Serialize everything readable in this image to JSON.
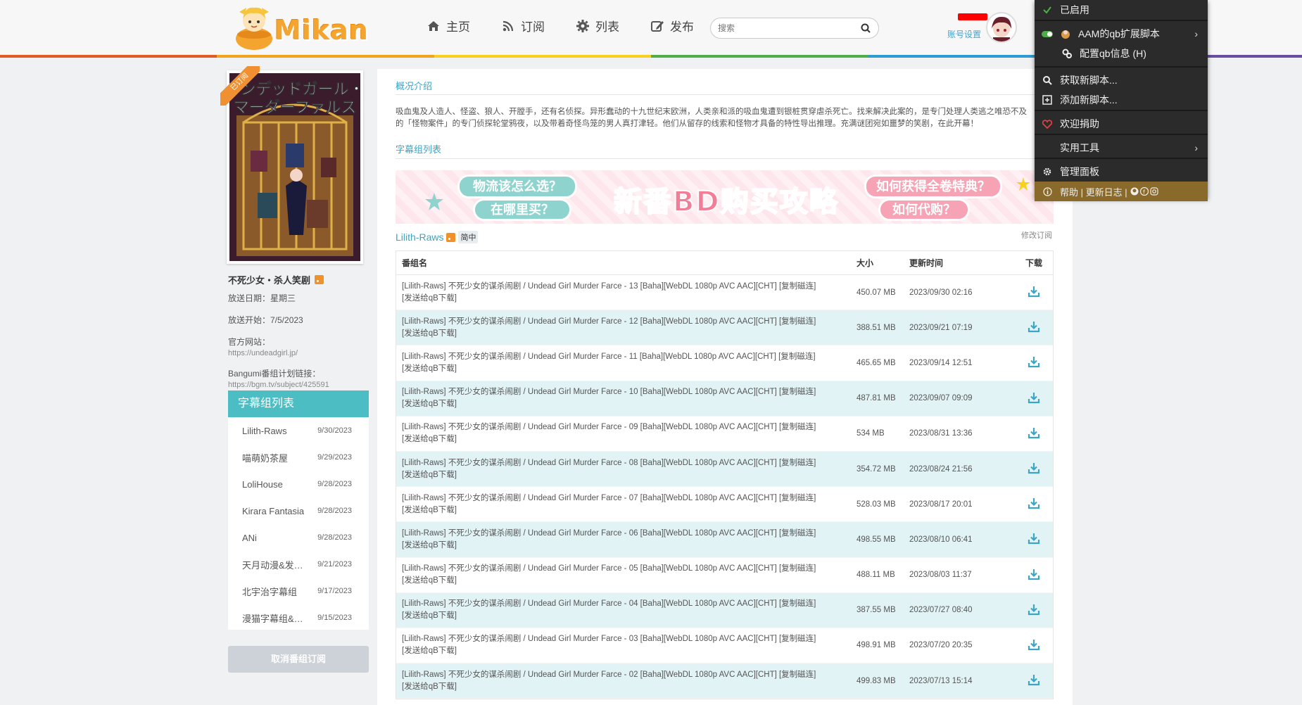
{
  "header": {
    "logo_text": "Mikan",
    "nav": [
      {
        "label": "主页",
        "icon": "home-icon"
      },
      {
        "label": "订阅",
        "icon": "rss-icon"
      },
      {
        "label": "列表",
        "icon": "gear-list-icon"
      },
      {
        "label": "发布",
        "icon": "edit-icon"
      }
    ],
    "search_placeholder": "搜索",
    "account_label": "账号设置"
  },
  "rainbow_colors": [
    "#e35a26",
    "#f2a31c",
    "#f7d11e",
    "#4fae4a",
    "#2d9bd6",
    "#6a4ea5"
  ],
  "sidebar": {
    "badge": "已订阅",
    "title": "不死少女・杀人笑剧",
    "air_day": "放送日期：星期三",
    "air_start": "放送开始：7/5/2023",
    "official_label": "官方网站：",
    "official_url": "https://undeadgirl.jp/",
    "bangumi_label": "Bangumi番组计划链接：",
    "bangumi_url": "https://bgm.tv/subject/425591",
    "fansub_title": "字幕组列表",
    "fansubs": [
      {
        "name": "Lilith-Raws",
        "date": "9/30/2023"
      },
      {
        "name": "喵萌奶茶屋",
        "date": "9/29/2023"
      },
      {
        "name": "LoliHouse",
        "date": "9/28/2023"
      },
      {
        "name": "Kirara Fantasia",
        "date": "9/28/2023"
      },
      {
        "name": "ANi",
        "date": "9/28/2023"
      },
      {
        "name": "天月动漫&发…",
        "date": "9/21/2023"
      },
      {
        "name": "北宇治字幕组",
        "date": "9/17/2023"
      },
      {
        "name": "漫猫字幕组&…",
        "date": "9/15/2023"
      }
    ],
    "unsubscribe": "取消番组订阅"
  },
  "main": {
    "overview_label": "概况介绍",
    "desc_line1": "吸血鬼及人造人、怪盗、狼人、开膛手，还有名侦探。异形蠢动的十九世纪末欧洲，人类亲和派的吸血鬼遭到银桩贯穿虐杀死亡。找来解决此案的，是专门处理人类逃之唯恐不及",
    "desc_line2": "的「怪物案件」的专门侦探轮堂鸦夜，以及带着奇怪鸟笼的男人真打津轻。他们从留存的线索和怪物才具备的特性导出推理。充满谜团宛如噩梦的笑剧，在此开幕！",
    "fansub_label": "字幕组列表",
    "banner": {
      "pill1": "物流该怎么选？",
      "pill2": "在哪里买？",
      "main_a": "新番",
      "main_b": "BD",
      "main_c": "购买攻略",
      "pill3": "如何获得全卷特典？",
      "pill4": "如何代购？"
    },
    "group_name": "Lilith-Raws",
    "lang_tag": "简中",
    "edit_sub": "修改订阅",
    "table": {
      "headers": {
        "name": "番组名",
        "size": "大小",
        "time": "更新时间",
        "download": "下载"
      },
      "rows": [
        {
          "name": "[Lilith-Raws] 不死少女的谋杀闹剧 / Undead Girl Murder Farce - 13 [Baha][WebDL 1080p AVC AAC][CHT] [复制磁连]",
          "push": "[发送给qB下载]",
          "size": "450.07 MB",
          "time": "2023/09/30 02:16"
        },
        {
          "name": "[Lilith-Raws] 不死少女的谋杀闹剧 / Undead Girl Murder Farce - 12 [Baha][WebDL 1080p AVC AAC][CHT] [复制磁连]",
          "push": "[发送给qB下载]",
          "size": "388.51 MB",
          "time": "2023/09/21 07:19"
        },
        {
          "name": "[Lilith-Raws] 不死少女的谋杀闹剧 / Undead Girl Murder Farce - 11 [Baha][WebDL 1080p AVC AAC][CHT] [复制磁连]",
          "push": "[发送给qB下载]",
          "size": "465.65 MB",
          "time": "2023/09/14 12:51"
        },
        {
          "name": "[Lilith-Raws] 不死少女的谋杀闹剧 / Undead Girl Murder Farce - 10 [Baha][WebDL 1080p AVC AAC][CHT] [复制磁连]",
          "push": "[发送给qB下载]",
          "size": "487.81 MB",
          "time": "2023/09/07 09:09"
        },
        {
          "name": "[Lilith-Raws] 不死少女的谋杀闹剧 / Undead Girl Murder Farce - 09 [Baha][WebDL 1080p AVC AAC][CHT] [复制磁连]",
          "push": "[发送给qB下载]",
          "size": "534 MB",
          "time": "2023/08/31 13:36"
        },
        {
          "name": "[Lilith-Raws] 不死少女的谋杀闹剧 / Undead Girl Murder Farce - 08 [Baha][WebDL 1080p AVC AAC][CHT] [复制磁连]",
          "push": "[发送给qB下载]",
          "size": "354.72 MB",
          "time": "2023/08/24 21:56"
        },
        {
          "name": "[Lilith-Raws] 不死少女的谋杀闹剧 / Undead Girl Murder Farce - 07 [Baha][WebDL 1080p AVC AAC][CHT] [复制磁连]",
          "push": "[发送给qB下载]",
          "size": "528.03 MB",
          "time": "2023/08/17 20:01"
        },
        {
          "name": "[Lilith-Raws] 不死少女的谋杀闹剧 / Undead Girl Murder Farce - 06 [Baha][WebDL 1080p AVC AAC][CHT] [复制磁连]",
          "push": "[发送给qB下载]",
          "size": "498.55 MB",
          "time": "2023/08/10 06:41"
        },
        {
          "name": "[Lilith-Raws] 不死少女的谋杀闹剧 / Undead Girl Murder Farce - 05 [Baha][WebDL 1080p AVC AAC][CHT] [复制磁连]",
          "push": "[发送给qB下载]",
          "size": "488.11 MB",
          "time": "2023/08/03 11:37"
        },
        {
          "name": "[Lilith-Raws] 不死少女的谋杀闹剧 / Undead Girl Murder Farce - 04 [Baha][WebDL 1080p AVC AAC][CHT] [复制磁连]",
          "push": "[发送给qB下载]",
          "size": "387.55 MB",
          "time": "2023/07/27 08:40"
        },
        {
          "name": "[Lilith-Raws] 不死少女的谋杀闹剧 / Undead Girl Murder Farce - 03 [Baha][WebDL 1080p AVC AAC][CHT] [复制磁连]",
          "push": "[发送给qB下载]",
          "size": "498.91 MB",
          "time": "2023/07/20 20:35"
        },
        {
          "name": "[Lilith-Raws] 不死少女的谋杀闹剧 / Undead Girl Murder Farce - 02 [Baha][WebDL 1080p AVC AAC][CHT] [复制磁连]",
          "push": "[发送给qB下载]",
          "size": "499.83 MB",
          "time": "2023/07/13 15:14"
        }
      ]
    }
  },
  "menu": {
    "enabled": "已启用",
    "script_name": "AAM的qb扩展脚本",
    "config": "配置qb信息 (H)",
    "get_scripts": "获取新脚本...",
    "add_script": "添加新脚本...",
    "donate": "欢迎捐助",
    "tools": "实用工具",
    "dashboard": "管理面板",
    "help": "帮助 | 更新日志 |"
  }
}
